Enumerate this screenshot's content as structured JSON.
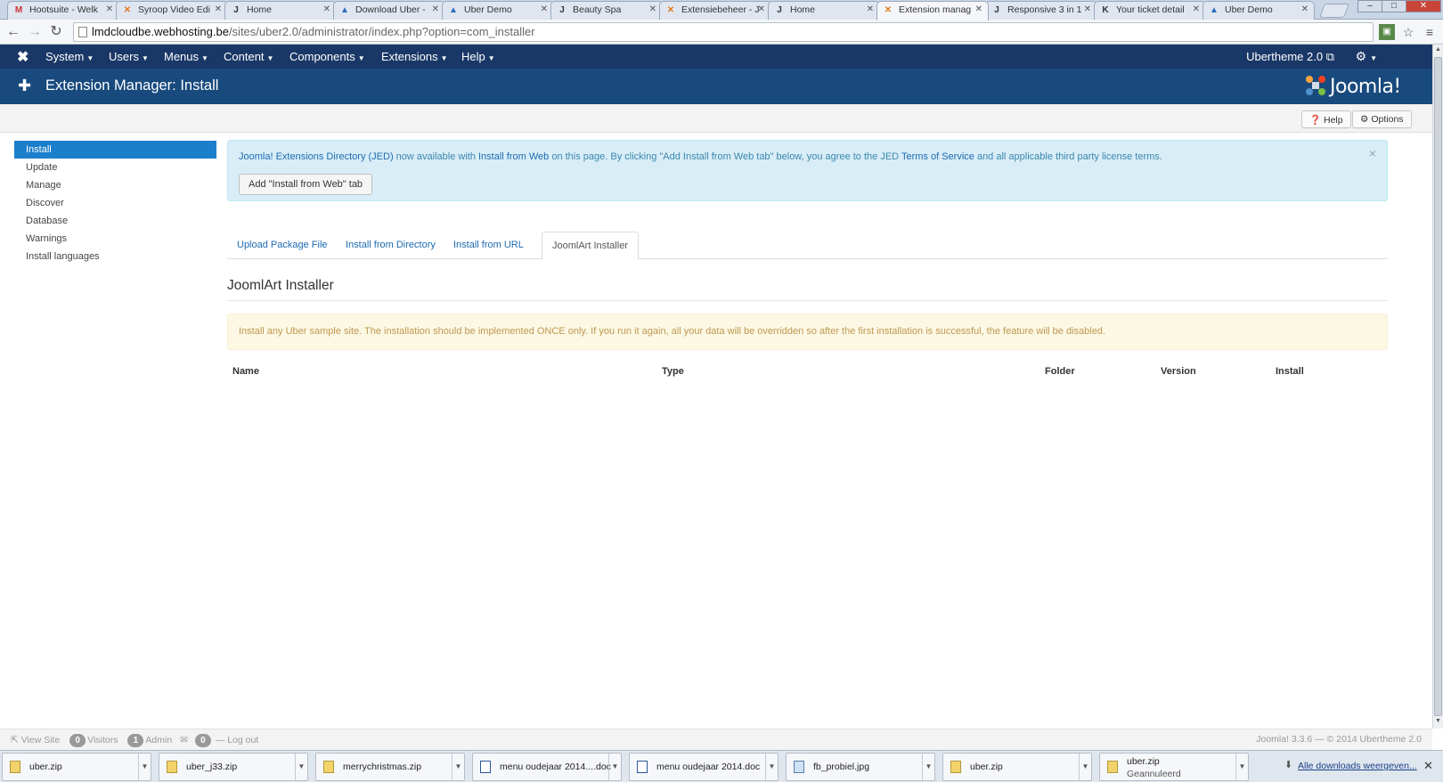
{
  "browser": {
    "tabs": [
      {
        "title": "Hootsuite - Welk",
        "icon": "M"
      },
      {
        "title": "Syroop Video Edi",
        "icon": "✕"
      },
      {
        "title": "Home",
        "icon": "J"
      },
      {
        "title": "Download Uber -",
        "icon": "▲"
      },
      {
        "title": "Uber Demo",
        "icon": "▲"
      },
      {
        "title": "Beauty Spa",
        "icon": "J"
      },
      {
        "title": "Extensiebeheer - J",
        "icon": "✕"
      },
      {
        "title": "Home",
        "icon": "J"
      },
      {
        "title": "Extension manag",
        "icon": "✕",
        "active": true
      },
      {
        "title": "Responsive 3 in 1",
        "icon": "J"
      },
      {
        "title": "Your ticket detail",
        "icon": "K"
      },
      {
        "title": "Uber Demo",
        "icon": "▲"
      }
    ],
    "url_host": "lmdcloudbe.webhosting.be",
    "url_path": "/sites/uber2.0/administrator/index.php?option=com_installer"
  },
  "topnav": {
    "items": [
      "System",
      "Users",
      "Menus",
      "Content",
      "Components",
      "Extensions",
      "Help"
    ],
    "site_name": "Ubertheme 2.0"
  },
  "header": {
    "title": "Extension Manager: Install",
    "logo_text": "Joomla!"
  },
  "toolbar": {
    "help_label": "Help",
    "options_label": "Options"
  },
  "sidebar": {
    "items": [
      "Install",
      "Update",
      "Manage",
      "Discover",
      "Database",
      "Warnings",
      "Install languages"
    ]
  },
  "jed_notice": {
    "link_jed": "Joomla! Extensions Directory (JED)",
    "text1": " now available with ",
    "link_iw": "Install from Web",
    "text2": " on this page.  By clicking \"Add Install from Web tab\" below, you agree to the JED ",
    "link_tos": "Terms of Service",
    "text3": " and all applicable third party license terms.",
    "close": "×",
    "button_label": "Add \"Install from Web\" tab"
  },
  "tabs": [
    "Upload Package File",
    "Install from Directory",
    "Install from URL",
    "JoomlArt Installer"
  ],
  "section": {
    "title": "JoomlArt Installer",
    "warning": "Install any Uber sample site. The installation should be implemented ONCE only. If you run it again, all your data will be overridden so after the first installation is successful, the feature will be disabled.",
    "columns": [
      "Name",
      "Type",
      "Folder",
      "Version",
      "Install"
    ]
  },
  "status": {
    "view_site": "View Site",
    "visitors_count": "0",
    "visitors_label": "Visitors",
    "admin_count": "1",
    "admin_label": "Admin",
    "messages_count": "0",
    "logout": "Log out",
    "version": "Joomla! 3.3.6  —  © 2014 Ubertheme 2.0"
  },
  "downloads": {
    "items": [
      {
        "name": "uber.zip",
        "type": "zip"
      },
      {
        "name": "uber_j33.zip",
        "type": "zip"
      },
      {
        "name": "merrychristmas.zip",
        "type": "zip"
      },
      {
        "name": "menu oudejaar 2014....doc",
        "type": "doc"
      },
      {
        "name": "menu oudejaar 2014.doc",
        "type": "doc"
      },
      {
        "name": "fb_probiel.jpg",
        "type": "img"
      },
      {
        "name": "uber.zip",
        "type": "zip"
      },
      {
        "name": "uber.zip",
        "type": "zip",
        "sub": "Geannuleerd"
      }
    ],
    "show_all": "Alle downloads weergeven..."
  },
  "colors": {
    "nav_bg": "#1a3867",
    "header_bg": "#184a7d",
    "active_item": "#1b7fcc",
    "link": "#1c6bb0"
  }
}
